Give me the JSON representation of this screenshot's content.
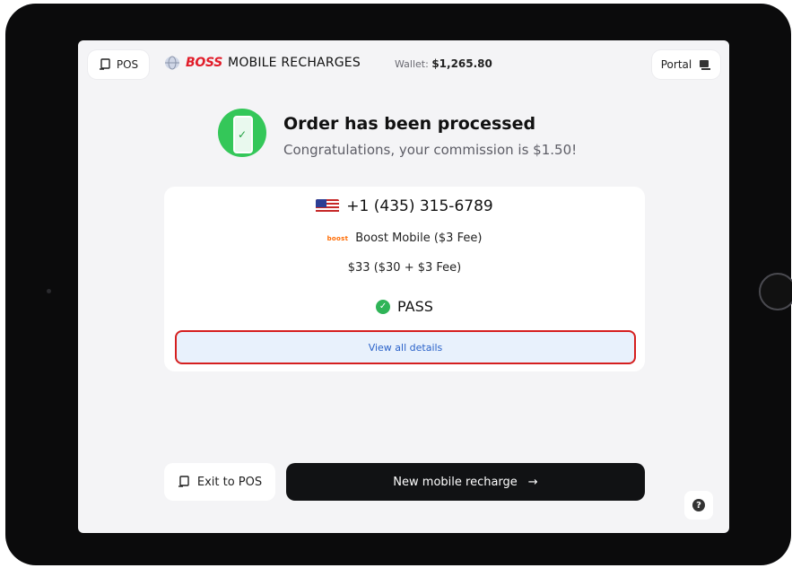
{
  "header": {
    "pos_label": "POS",
    "brand_logo": "BOSS",
    "brand_title": "MOBILE RECHARGES",
    "wallet_label": "Wallet:",
    "wallet_value": "$1,265.80",
    "portal_label": "Portal"
  },
  "order": {
    "title": "Order has been processed",
    "subtitle": "Congratulations, your commission is $1.50!"
  },
  "summary": {
    "phone_number": "+1 (435) 315-6789",
    "carrier_logo": "boost",
    "carrier": "Boost Mobile ($3 Fee)",
    "amount": "$33 ($30 + $3 Fee)",
    "status": "PASS",
    "view_details": "View all details"
  },
  "footer": {
    "exit_label": "Exit to POS",
    "new_recharge_label": "New mobile recharge",
    "arrow": "→"
  },
  "colors": {
    "accent_green": "#34c759",
    "primary_button": "#111214",
    "highlight_border": "#d51f1f",
    "link_blue": "#2a62c9"
  },
  "icons": [
    "pos-icon",
    "portal-icon",
    "flag-us-icon",
    "check-circle-icon",
    "arrow-right-icon",
    "help-icon",
    "phone-success-icon"
  ]
}
